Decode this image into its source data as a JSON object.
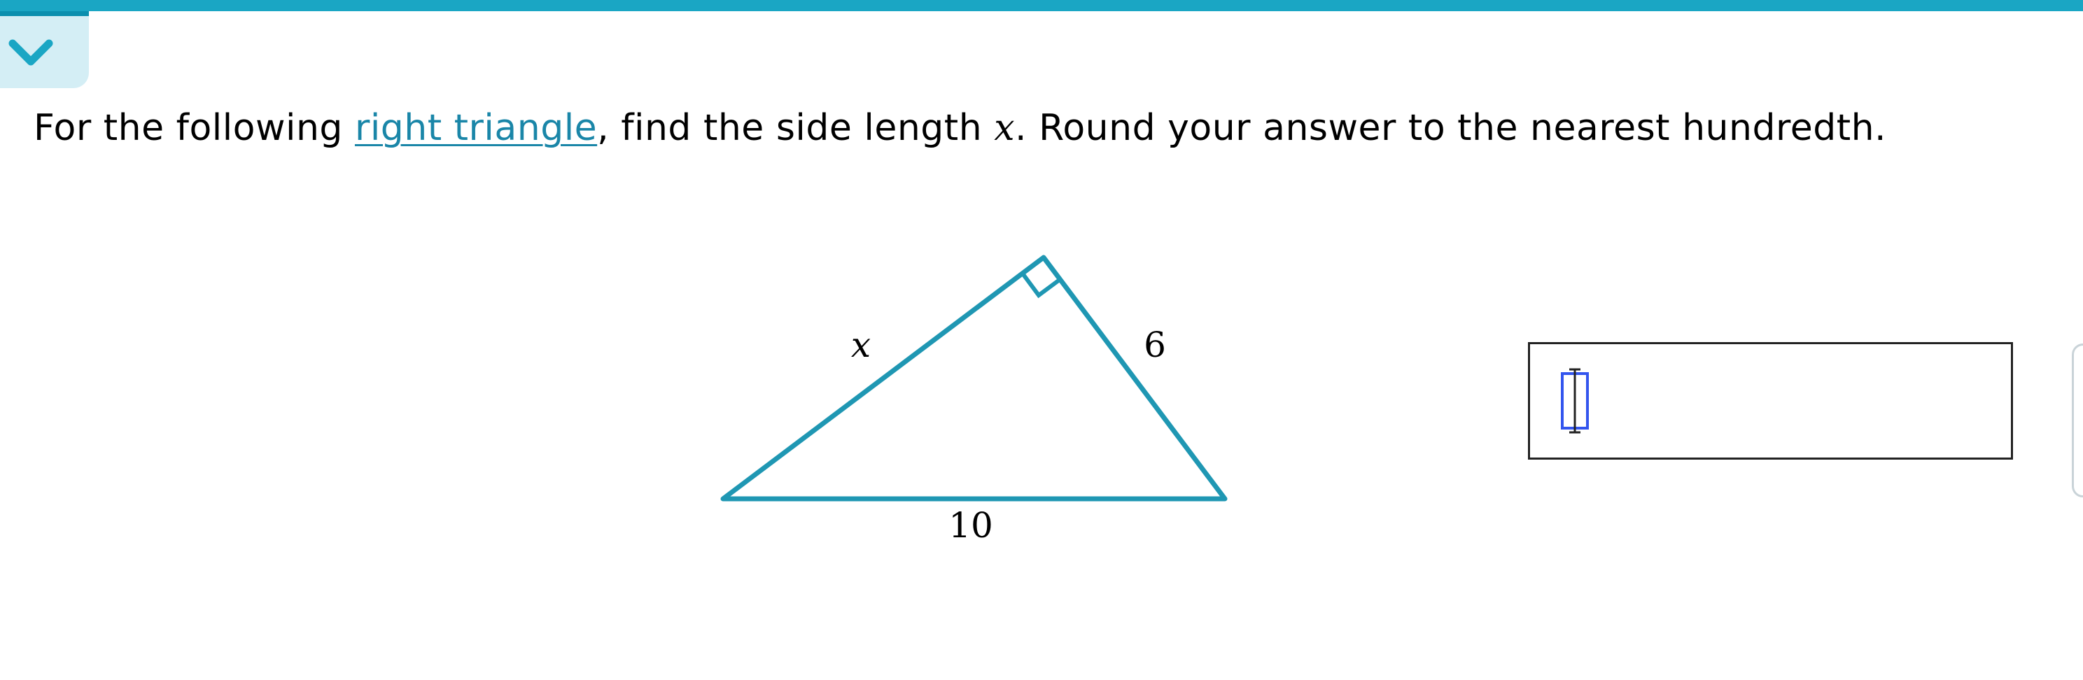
{
  "header": {
    "collapse_icon": "chevron-down-icon",
    "accent_color": "#1aa6c4"
  },
  "question": {
    "prefix": "For the following ",
    "link_text": "right triangle",
    "middle": ", find the side length ",
    "variable": "x",
    "suffix": ". Round your answer to the nearest hundredth."
  },
  "figure": {
    "label_hypotenuse_leg_x": "x",
    "label_leg_6": "6",
    "label_base": "10",
    "stroke_color": "#1f97b3"
  },
  "answer": {
    "value": "",
    "caret_icon": "text-cursor-icon"
  }
}
